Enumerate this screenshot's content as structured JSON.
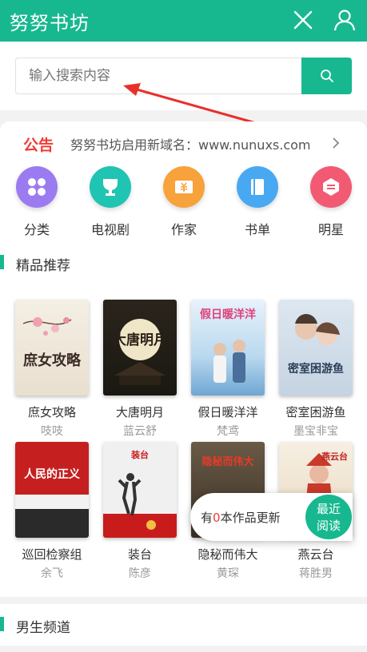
{
  "header": {
    "title": "努努书坊",
    "close_icon": "close-icon",
    "user_icon": "user-icon"
  },
  "search": {
    "placeholder": "输入搜索内容",
    "button_icon": "search-icon"
  },
  "notice": {
    "tag": "公告",
    "text": "努努书坊启用新域名：www.nunuxs.com"
  },
  "categories": [
    {
      "label": "分类",
      "icon": "grid-icon",
      "color": "#9b7cf0"
    },
    {
      "label": "电视剧",
      "icon": "trophy-icon",
      "color": "#20c4b2"
    },
    {
      "label": "作家",
      "icon": "ticket-icon",
      "color": "#f7a23b"
    },
    {
      "label": "书单",
      "icon": "book-icon",
      "color": "#49a8f2"
    },
    {
      "label": "明星",
      "icon": "badge-icon",
      "color": "#f25a74"
    }
  ],
  "featured": {
    "title": "精品推荐",
    "books": [
      {
        "title": "庶女攻略",
        "author": "吱吱",
        "cover_text": "庶女攻略"
      },
      {
        "title": "大唐明月",
        "author": "蓝云舒",
        "cover_text": "大唐明月"
      },
      {
        "title": "假日暖洋洋",
        "author": "梵鸢",
        "cover_text": "假日暖洋洋"
      },
      {
        "title": "密室困游鱼",
        "author": "墨宝非宝",
        "cover_text": "密室困游鱼"
      },
      {
        "title": "巡回检察组",
        "author": "余飞",
        "cover_text": "人民的正义"
      },
      {
        "title": "装台",
        "author": "陈彦",
        "cover_text": "装台"
      },
      {
        "title": "隐秘而伟大",
        "author": "黄琛",
        "cover_text": "隐秘而伟大"
      },
      {
        "title": "燕云台",
        "author": "蒋胜男",
        "cover_text": "燕云台"
      }
    ]
  },
  "float_bar": {
    "text_pre": "有",
    "count": "0",
    "text_post": "本作品更新",
    "button_line1": "最近",
    "button_line2": "阅读"
  },
  "male_section": {
    "title": "男生频道"
  },
  "colors": {
    "accent": "#17b88f",
    "notice_red": "#ef3b33"
  }
}
